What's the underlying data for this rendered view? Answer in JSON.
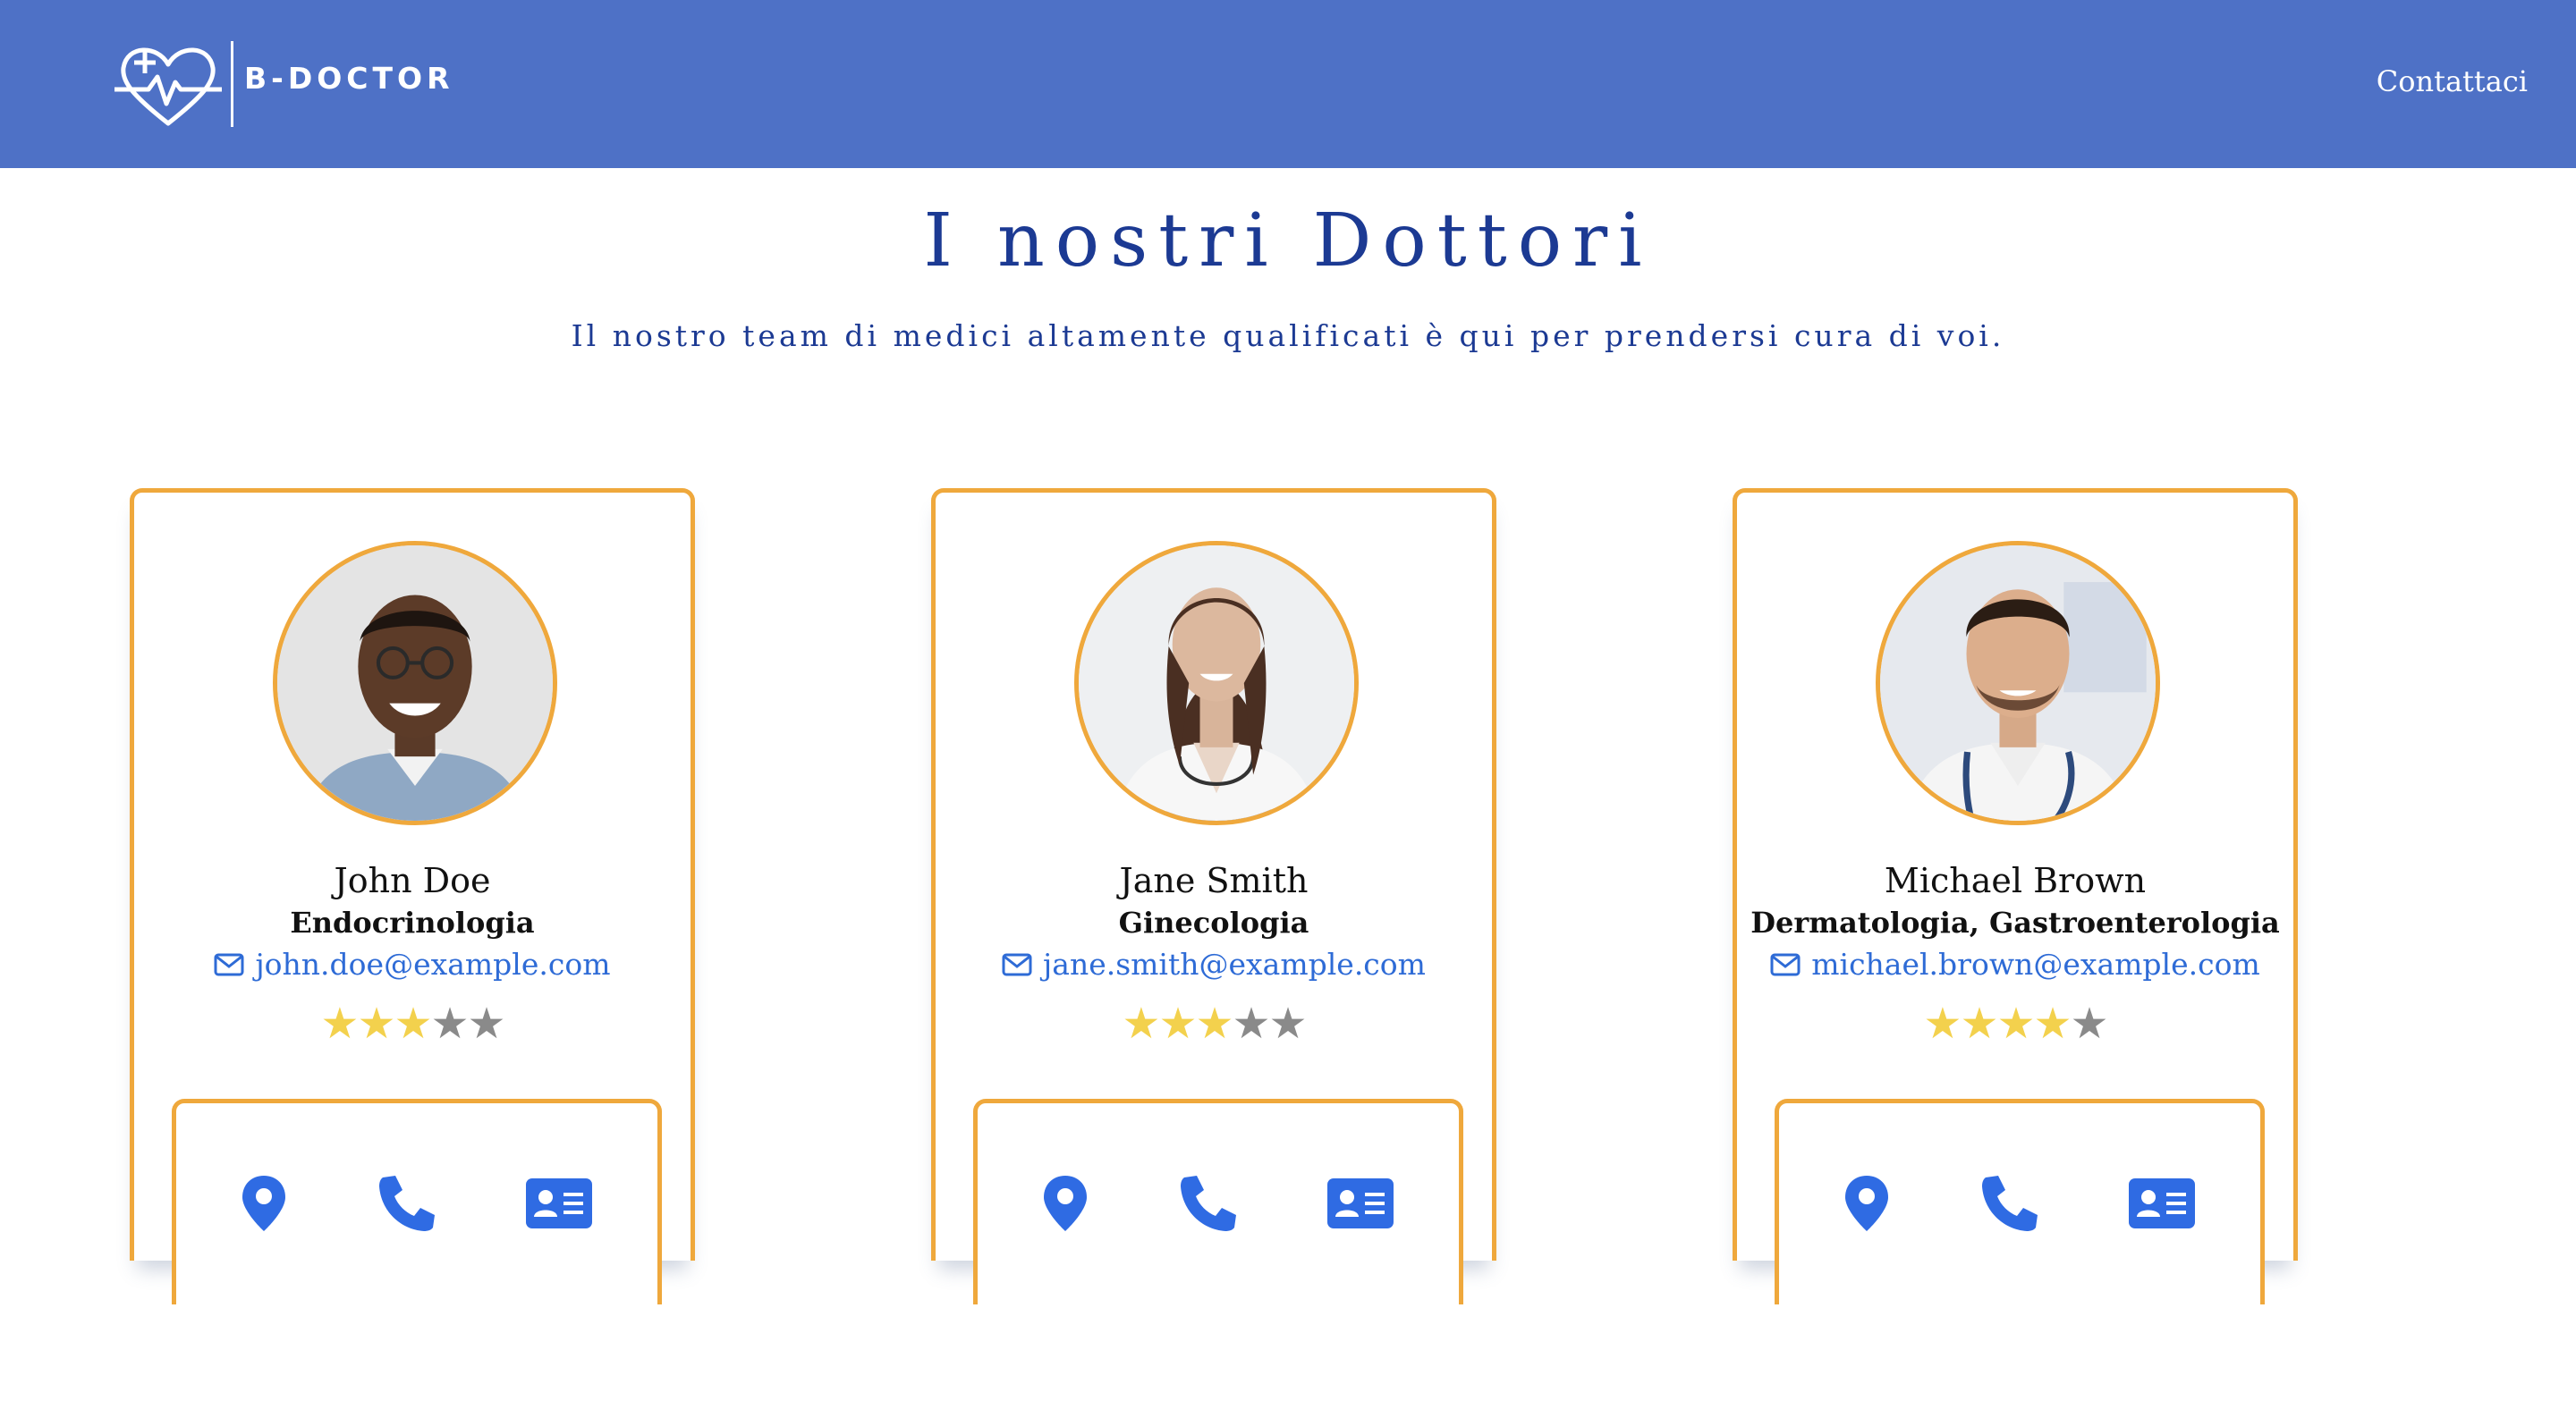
{
  "header": {
    "brand": "B-DOCTOR",
    "nav_contact": "Contattaci",
    "bg_color": "#4e71c6"
  },
  "main": {
    "title": "I nostri Dottori",
    "subtitle": "Il nostro team di medici altamente qualificati è qui per prendersi cura di voi."
  },
  "colors": {
    "accent_border": "#efa83c",
    "link_blue": "#2e6bd6",
    "icon_blue": "#2f6be3",
    "title_blue": "#1c3a93",
    "star_on": "#f3d14d",
    "star_off": "#8a8a8a"
  },
  "doctors": [
    {
      "name": "John Doe",
      "specialty": "Endocrinologia",
      "email": "john.doe@example.com",
      "rating": 3,
      "max_rating": 5,
      "actions": [
        "location-pin-icon",
        "phone-icon",
        "id-card-icon"
      ]
    },
    {
      "name": "Jane Smith",
      "specialty": "Ginecologia",
      "email": "jane.smith@example.com",
      "rating": 3,
      "max_rating": 5,
      "actions": [
        "location-pin-icon",
        "phone-icon",
        "id-card-icon"
      ]
    },
    {
      "name": "Michael Brown",
      "specialty": "Dermatologia, Gastroenterologia",
      "email": "michael.brown@example.com",
      "rating": 4,
      "max_rating": 5,
      "actions": [
        "location-pin-icon",
        "phone-icon",
        "id-card-icon"
      ]
    }
  ]
}
